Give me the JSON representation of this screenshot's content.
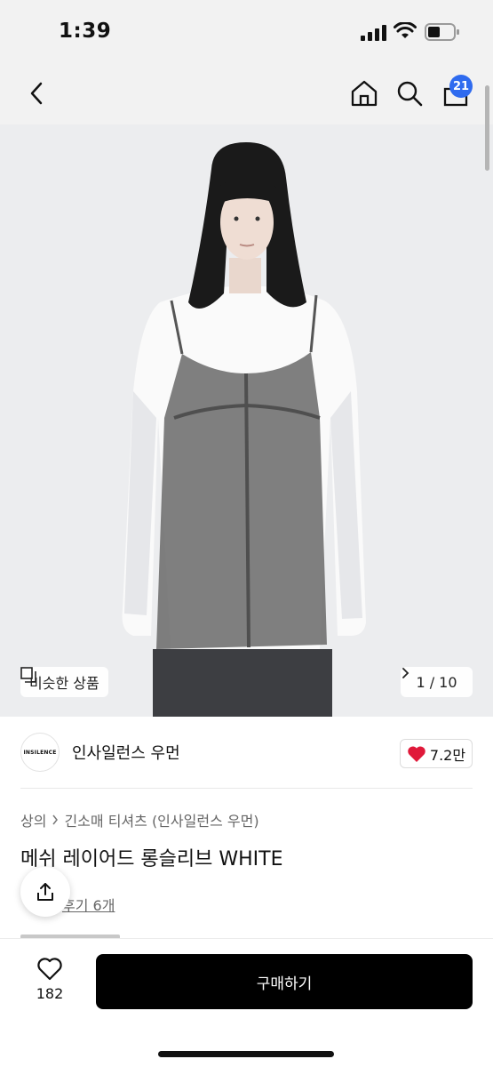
{
  "status_bar": {
    "time": "1:39"
  },
  "nav": {
    "cart_badge": "21"
  },
  "hero": {
    "similar_label": "비슷한 상품",
    "pager": "1 / 10"
  },
  "brand": {
    "logo_text": "INSILENCE",
    "name": "인사일런스 우먼",
    "like_count": "7.2만"
  },
  "product": {
    "breadcrumb": [
      "상의",
      "긴소매 티셔츠 (인사일런스 우먼)"
    ],
    "title": "메쉬 레이어드 롱슬리브 WHITE",
    "review_link": "후기 6개"
  },
  "bottom": {
    "wish_count": "182",
    "buy_label": "구매하기"
  },
  "colors": {
    "accent_badge": "#2f6bef",
    "heart": "#e0193a",
    "buy_button": "#000000"
  }
}
